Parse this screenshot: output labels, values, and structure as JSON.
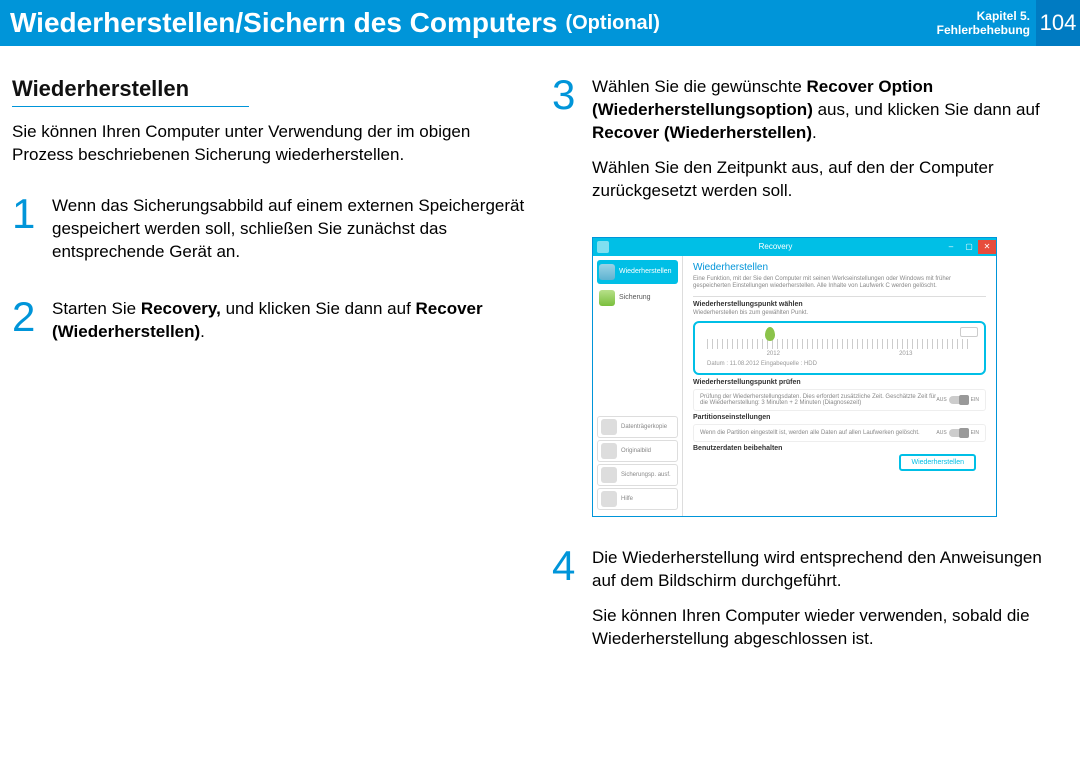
{
  "header": {
    "title": "Wiederherstellen/Sichern des Computers",
    "optional": "(Optional)",
    "chapter_line1": "Kapitel 5.",
    "chapter_line2": "Fehlerbehebung",
    "page_number": "104"
  },
  "left": {
    "section_heading": "Wiederherstellen",
    "intro": "Sie können Ihren Computer unter Verwendung der im obigen Prozess beschriebenen Sicherung wiederherstellen.",
    "steps": [
      {
        "num": "1",
        "body_html": "Wenn das Sicherungsabbild auf einem externen Speichergerät gespeichert werden soll, schließen Sie zunächst das entsprechende Gerät an."
      },
      {
        "num": "2",
        "body_html": "Starten Sie <b>Recovery,</b> und klicken Sie dann auf <b>Recover (Wiederherstellen)</b>."
      }
    ]
  },
  "right": {
    "steps": [
      {
        "num": "3",
        "body_html": "Wählen Sie die gewünschte <b>Recover Option (Wiederherstellungsoption)</b> aus, und klicken Sie dann auf <b>Recover (Wiederherstellen)</b>.",
        "extra": "Wählen Sie den Zeitpunkt aus, auf den der Computer zurückgesetzt werden soll."
      },
      {
        "num": "4",
        "body_html": "Die Wiederherstellung wird entsprechend den Anweisungen auf dem Bildschirm durchgeführt.",
        "extra": "Sie können Ihren Computer wieder verwenden, sobald die Wiederherstellung abgeschlossen ist."
      }
    ]
  },
  "screenshot": {
    "window_title": "Recovery",
    "side": {
      "recover": "Wiederherstellen",
      "backup": "Sicherung",
      "disk_copy": "Datenträgerkopie",
      "original": "Originalbild",
      "create_backup": "Sicherungsp. ausf.",
      "help": "Hilfe"
    },
    "main": {
      "heading": "Wiederherstellen",
      "desc": "Eine Funktion, mit der Sie den Computer mit seinen Werkseinstellungen oder Windows mit früher gespeicherten Einstellungen wiederherstellen. Alle Inhalte von Laufwerk C werden gelöscht.",
      "sub1": "Wiederherstellungspunkt wählen",
      "sub1_caption": "Wiederherstellen bis zum gewählten Punkt.",
      "year1": "2012",
      "year2": "2013",
      "date_line": "Datum : 11.08.2012    Eingabequelle : HDD",
      "sub2": "Wiederherstellungspunkt prüfen",
      "sub2_desc": "Prüfung der Wiederherstellungsdaten. Dies erfordert zusätzliche Zeit. Geschätzte Zeit für die Wiederherstellung: 3 Minuten + 2 Minuten (Diagnosezeit)",
      "sub3": "Partitionseinstellungen",
      "sub3_desc": "Wenn die Partition eingestellt ist, werden alle Daten auf allen Laufwerken gelöscht.",
      "sub4": "Benutzerdaten beibehalten",
      "toggle_off": "AUS",
      "toggle_on": "EIN",
      "recover_btn": "Wiederherstellen"
    }
  }
}
